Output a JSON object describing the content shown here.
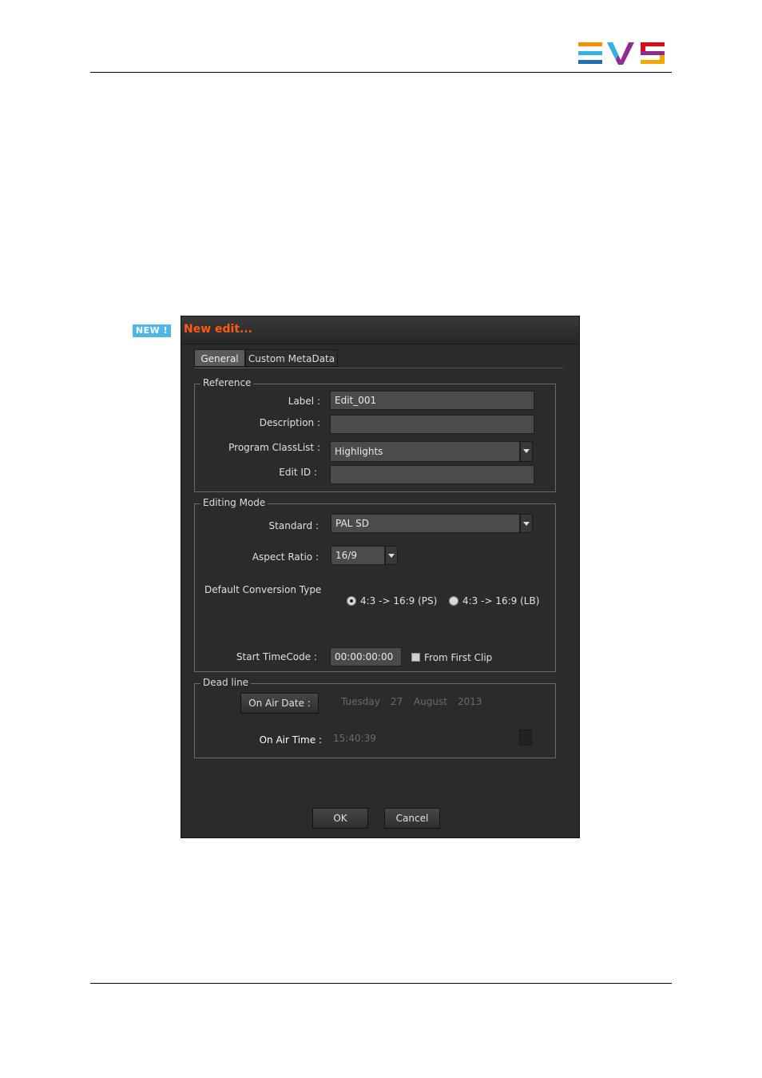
{
  "brand": {
    "logo_text": "EVS",
    "logo_colors": [
      "#f39200",
      "#2fb3e6",
      "#1f6fb2",
      "#8e2c8f",
      "#e30613",
      "#f7a600"
    ]
  },
  "badge": {
    "label": "NEW !"
  },
  "dialog": {
    "title": "New edit...",
    "tabs": [
      {
        "label": "General",
        "active": true
      },
      {
        "label": "Custom MetaData",
        "active": false
      }
    ],
    "reference": {
      "legend": "Reference",
      "label_label": "Label :",
      "label_value": "Edit_001",
      "description_label": "Description :",
      "description_value": "",
      "program_classlist_label": "Program ClassList :",
      "program_classlist_value": "Highlights",
      "edit_id_label": "Edit ID :",
      "edit_id_value": ""
    },
    "editing_mode": {
      "legend": "Editing Mode",
      "standard_label": "Standard :",
      "standard_value": "PAL SD",
      "aspect_ratio_label": "Aspect Ratio :",
      "aspect_ratio_value": "16/9",
      "conversion_label": "Default Conversion Type",
      "conversion_options": [
        {
          "label": "4:3 -> 16:9 (PS)",
          "selected": true
        },
        {
          "label": "4:3 -> 16:9 (LB)",
          "selected": false
        }
      ],
      "start_timecode_label": "Start TimeCode :",
      "start_timecode_value": "00:00:00:00",
      "from_first_clip_label": "From First Clip",
      "from_first_clip_checked": false
    },
    "deadline": {
      "legend": "Dead line",
      "on_air_date_button": "On Air Date :",
      "date_weekday": "Tuesday",
      "date_day": "27",
      "date_month": "August",
      "date_year": "2013",
      "on_air_time_label": "On Air Time :",
      "on_air_time_value": "15:40:39"
    },
    "buttons": {
      "ok": "OK",
      "cancel": "Cancel"
    }
  }
}
